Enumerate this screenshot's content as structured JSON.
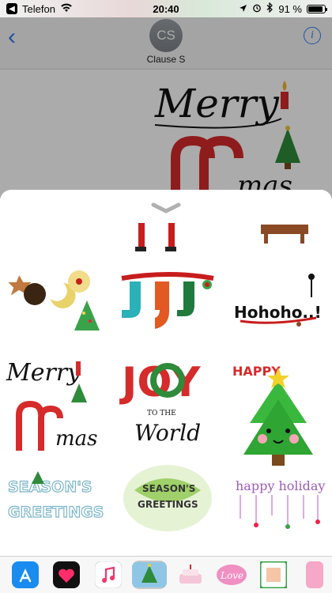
{
  "status": {
    "carrier": "Telefon",
    "time": "20:40",
    "battery": "91 %"
  },
  "header": {
    "avatar_initials": "CS",
    "contact_name": "Clause S"
  },
  "stickers": {
    "merry_word": "Merry",
    "mas_word": "mas",
    "hohoho": "Hohoho..!",
    "joy": "JOY",
    "to_the": "TO THE",
    "world": "World",
    "happy": "HAPPY",
    "seasons1": "SEASON'S",
    "greetings": "GREETINGS",
    "seasons2": "SEASON'S",
    "greetings2": "GREETINGS",
    "happy_holiday": "happy holiday",
    "love": "Love"
  },
  "colors": {
    "accent": "#3478f6",
    "christmas_red": "#d62b2b",
    "christmas_green": "#2e8b3a"
  }
}
